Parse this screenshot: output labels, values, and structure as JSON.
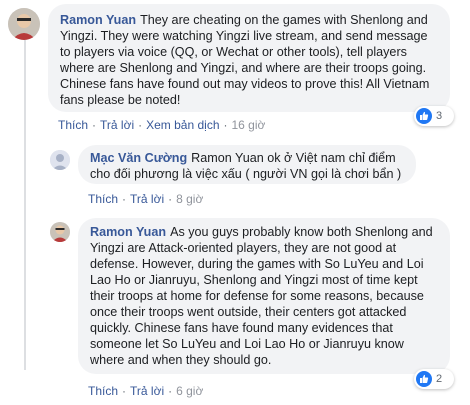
{
  "comments": [
    {
      "author": "Ramon Yuan",
      "text": "They are cheating on the games with Shenlong and Yingzi. They were watching Yingzi live stream, and send message to players via voice (QQ, or Wechat or other tools), tell players where are Shenlong and Yingzi, and where are their troops going. Chinese fans have found out may videos to prove this! All Vietnam fans please be noted!",
      "like_label": "Thích",
      "reply_label": "Trả lời",
      "translate_label": "Xem bản dịch",
      "time": "16 giờ",
      "reaction_count": "3"
    },
    {
      "author": "Mạc Văn Cường",
      "text": "Ramon Yuan ok ở Việt nam chỉ điểm cho đối phương là việc xấu ( người VN gọi là chơi bẩn )",
      "like_label": "Thích",
      "reply_label": "Trả lời",
      "time": "8 giờ"
    },
    {
      "author": "Ramon Yuan",
      "text": "As you guys probably know both Shenlong and Yingzi are Attack-oriented players, they are not good at defense. However, during the games with So LuYeu and Loi Lao Ho or Jianruyu, Shenlong and Yingzi most of time kept their troops at home for defense for some reasons, because once their troops went outside, their centers got attacked quickly. Chinese fans have found many evidences that someone let So LuYeu and Loi Lao Ho or Jianruyu know where and when they should go.",
      "like_label": "Thích",
      "reply_label": "Trả lời",
      "time": "6 giờ",
      "reaction_count": "2"
    }
  ],
  "colors": {
    "name": "#385898",
    "bubble": "#f2f3f5",
    "like_blue": "#2078f4"
  }
}
